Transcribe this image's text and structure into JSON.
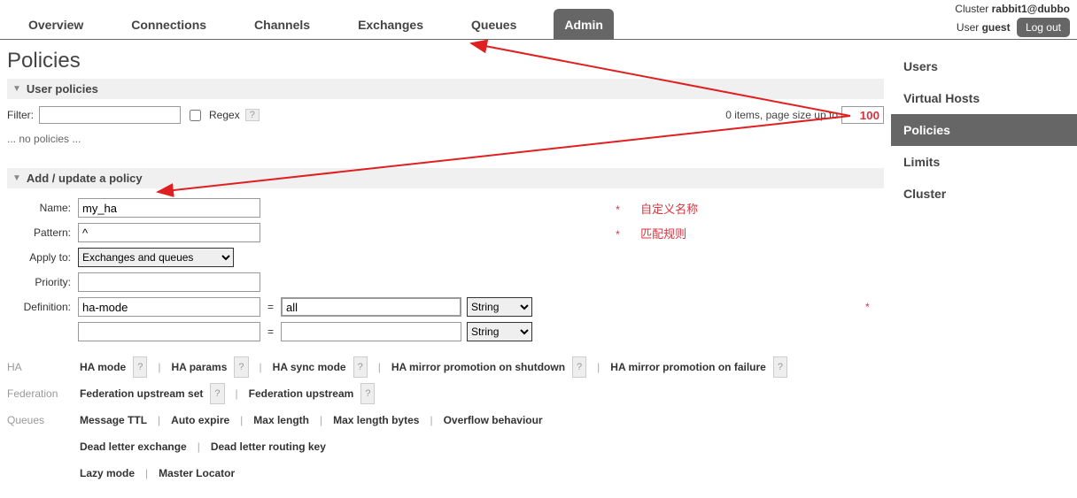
{
  "header": {
    "tabs": [
      "Overview",
      "Connections",
      "Channels",
      "Exchanges",
      "Queues",
      "Admin"
    ],
    "cluster_label": "Cluster",
    "cluster_name": "rabbit1@dubbo",
    "user_label": "User",
    "user_name": "guest",
    "logout": "Log out"
  },
  "page_title": "Policies",
  "sidebar": {
    "items": [
      "Users",
      "Virtual Hosts",
      "Policies",
      "Limits",
      "Cluster"
    ]
  },
  "user_policies": {
    "title": "User policies",
    "filter_label": "Filter:",
    "filter_value": "",
    "regex_label": "Regex",
    "pager_text": "0 items, page size up to",
    "pager_value": "100",
    "empty": "... no policies ..."
  },
  "add_policy": {
    "title": "Add / update a policy",
    "labels": {
      "name": "Name:",
      "pattern": "Pattern:",
      "apply": "Apply to:",
      "priority": "Priority:",
      "definition": "Definition:"
    },
    "name": "my_ha",
    "pattern": "^",
    "apply_option": "Exchanges and queues",
    "priority": "",
    "def_key": "ha-mode",
    "def_val": "all",
    "type_option": "String",
    "annotations": {
      "name": "自定义名称",
      "pattern": "匹配规则"
    }
  },
  "hints": {
    "groups": [
      {
        "label": "HA",
        "rows": [
          [
            "HA mode",
            "HA params",
            "HA sync mode",
            "HA mirror promotion on shutdown",
            "HA mirror promotion on failure"
          ]
        ]
      },
      {
        "label": "Federation",
        "rows": [
          [
            "Federation upstream set",
            "Federation upstream"
          ]
        ]
      },
      {
        "label": "Queues",
        "rows": [
          [
            "Message TTL",
            "Auto expire",
            "Max length",
            "Max length bytes",
            "Overflow behaviour"
          ],
          [
            "Dead letter exchange",
            "Dead letter routing key"
          ],
          [
            "Lazy mode",
            "Master Locator"
          ]
        ]
      }
    ]
  }
}
